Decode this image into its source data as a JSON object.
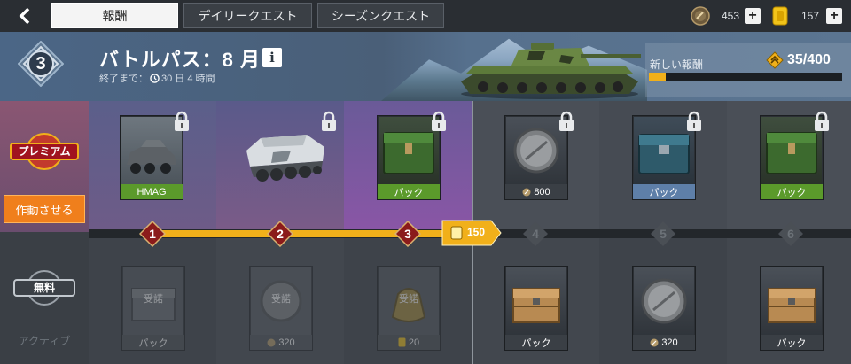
{
  "tabs": [
    {
      "label": "報酬",
      "active": true
    },
    {
      "label": "デイリークエスト",
      "active": false
    },
    {
      "label": "シーズンクエスト",
      "active": false
    }
  ],
  "currency": {
    "silver": "453",
    "gold": "157"
  },
  "header": {
    "level": "3",
    "title": "バトルパス：8 月",
    "info": "i",
    "until_label": "終了まで：",
    "until_time": "30 日 4 時間",
    "new_rewards_label": "新しい報酬",
    "new_rewards_count": "35/400",
    "new_rewards_fraction": 0.0875
  },
  "sidebar": {
    "premium": "プレミアム",
    "activate": "作動させる",
    "free": "無料",
    "active": "アクティブ"
  },
  "milestones": [
    {
      "n": "1",
      "reached": true
    },
    {
      "n": "2",
      "reached": true
    },
    {
      "n": "3",
      "reached": true
    },
    {
      "n": "4",
      "reached": false
    },
    {
      "n": "5",
      "reached": false
    },
    {
      "n": "6",
      "reached": false
    }
  ],
  "progress": {
    "cost": "150"
  },
  "premium_rewards": [
    {
      "label": "HMAG",
      "icon": "armored-car",
      "locked": true,
      "bordered": true
    },
    {
      "label": "",
      "icon": "halftrack",
      "locked": true,
      "bordered": false
    },
    {
      "label": "パック",
      "icon": "green-crate",
      "locked": true,
      "bordered": true
    },
    {
      "label": "800",
      "icon": "silver-coin",
      "locked": true,
      "bordered": true,
      "currency": true
    },
    {
      "label": "パック",
      "icon": "blue-crate",
      "locked": true,
      "bordered": true
    },
    {
      "label": "パック",
      "icon": "green-crate",
      "locked": true,
      "bordered": true
    }
  ],
  "free_rewards": [
    {
      "label": "パック",
      "icon": "crate",
      "received": true,
      "received_label": "受諾"
    },
    {
      "label": "320",
      "icon": "silver-coin",
      "received": true,
      "received_label": "受諾",
      "currency": true
    },
    {
      "label": "20",
      "icon": "gold-bag",
      "received": true,
      "received_label": "受諾",
      "currency": true
    },
    {
      "label": "パック",
      "icon": "wooden-crate",
      "received": false
    },
    {
      "label": "320",
      "icon": "silver-coin",
      "received": false,
      "currency": true
    },
    {
      "label": "パック",
      "icon": "wooden-crate",
      "received": false
    }
  ],
  "colors": {
    "accent": "#f1b01a",
    "orange": "#f07f1c",
    "premium_purple": "#7a4f75",
    "label_green": "#5b9a2b",
    "label_blue": "#5e7fa8",
    "diamond_red": "#8b1b1b"
  }
}
